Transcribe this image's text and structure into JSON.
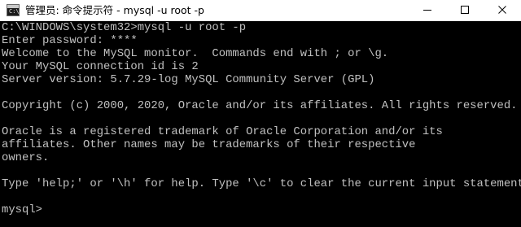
{
  "window": {
    "title": "管理员: 命令提示符 - mysql  -u root -p",
    "icon": "terminal-icon",
    "controls": {
      "minimize": "minimize-icon",
      "maximize": "maximize-icon",
      "close": "close-icon"
    }
  },
  "console": {
    "lines": [
      "C:\\WINDOWS\\system32>mysql -u root -p",
      "Enter password: ****",
      "Welcome to the MySQL monitor.  Commands end with ; or \\g.",
      "Your MySQL connection id is 2",
      "Server version: 5.7.29-log MySQL Community Server (GPL)",
      "",
      "Copyright (c) 2000, 2020, Oracle and/or its affiliates. All rights reserved.",
      "",
      "Oracle is a registered trademark of Oracle Corporation and/or its",
      "affiliates. Other names may be trademarks of their respective",
      "owners.",
      "",
      "Type 'help;' or '\\h' for help. Type '\\c' to clear the current input statement.",
      "",
      "mysql>"
    ]
  },
  "colors": {
    "console_background": "#000000",
    "console_text": "#c0c0c0",
    "titlebar_background": "#ffffff"
  }
}
